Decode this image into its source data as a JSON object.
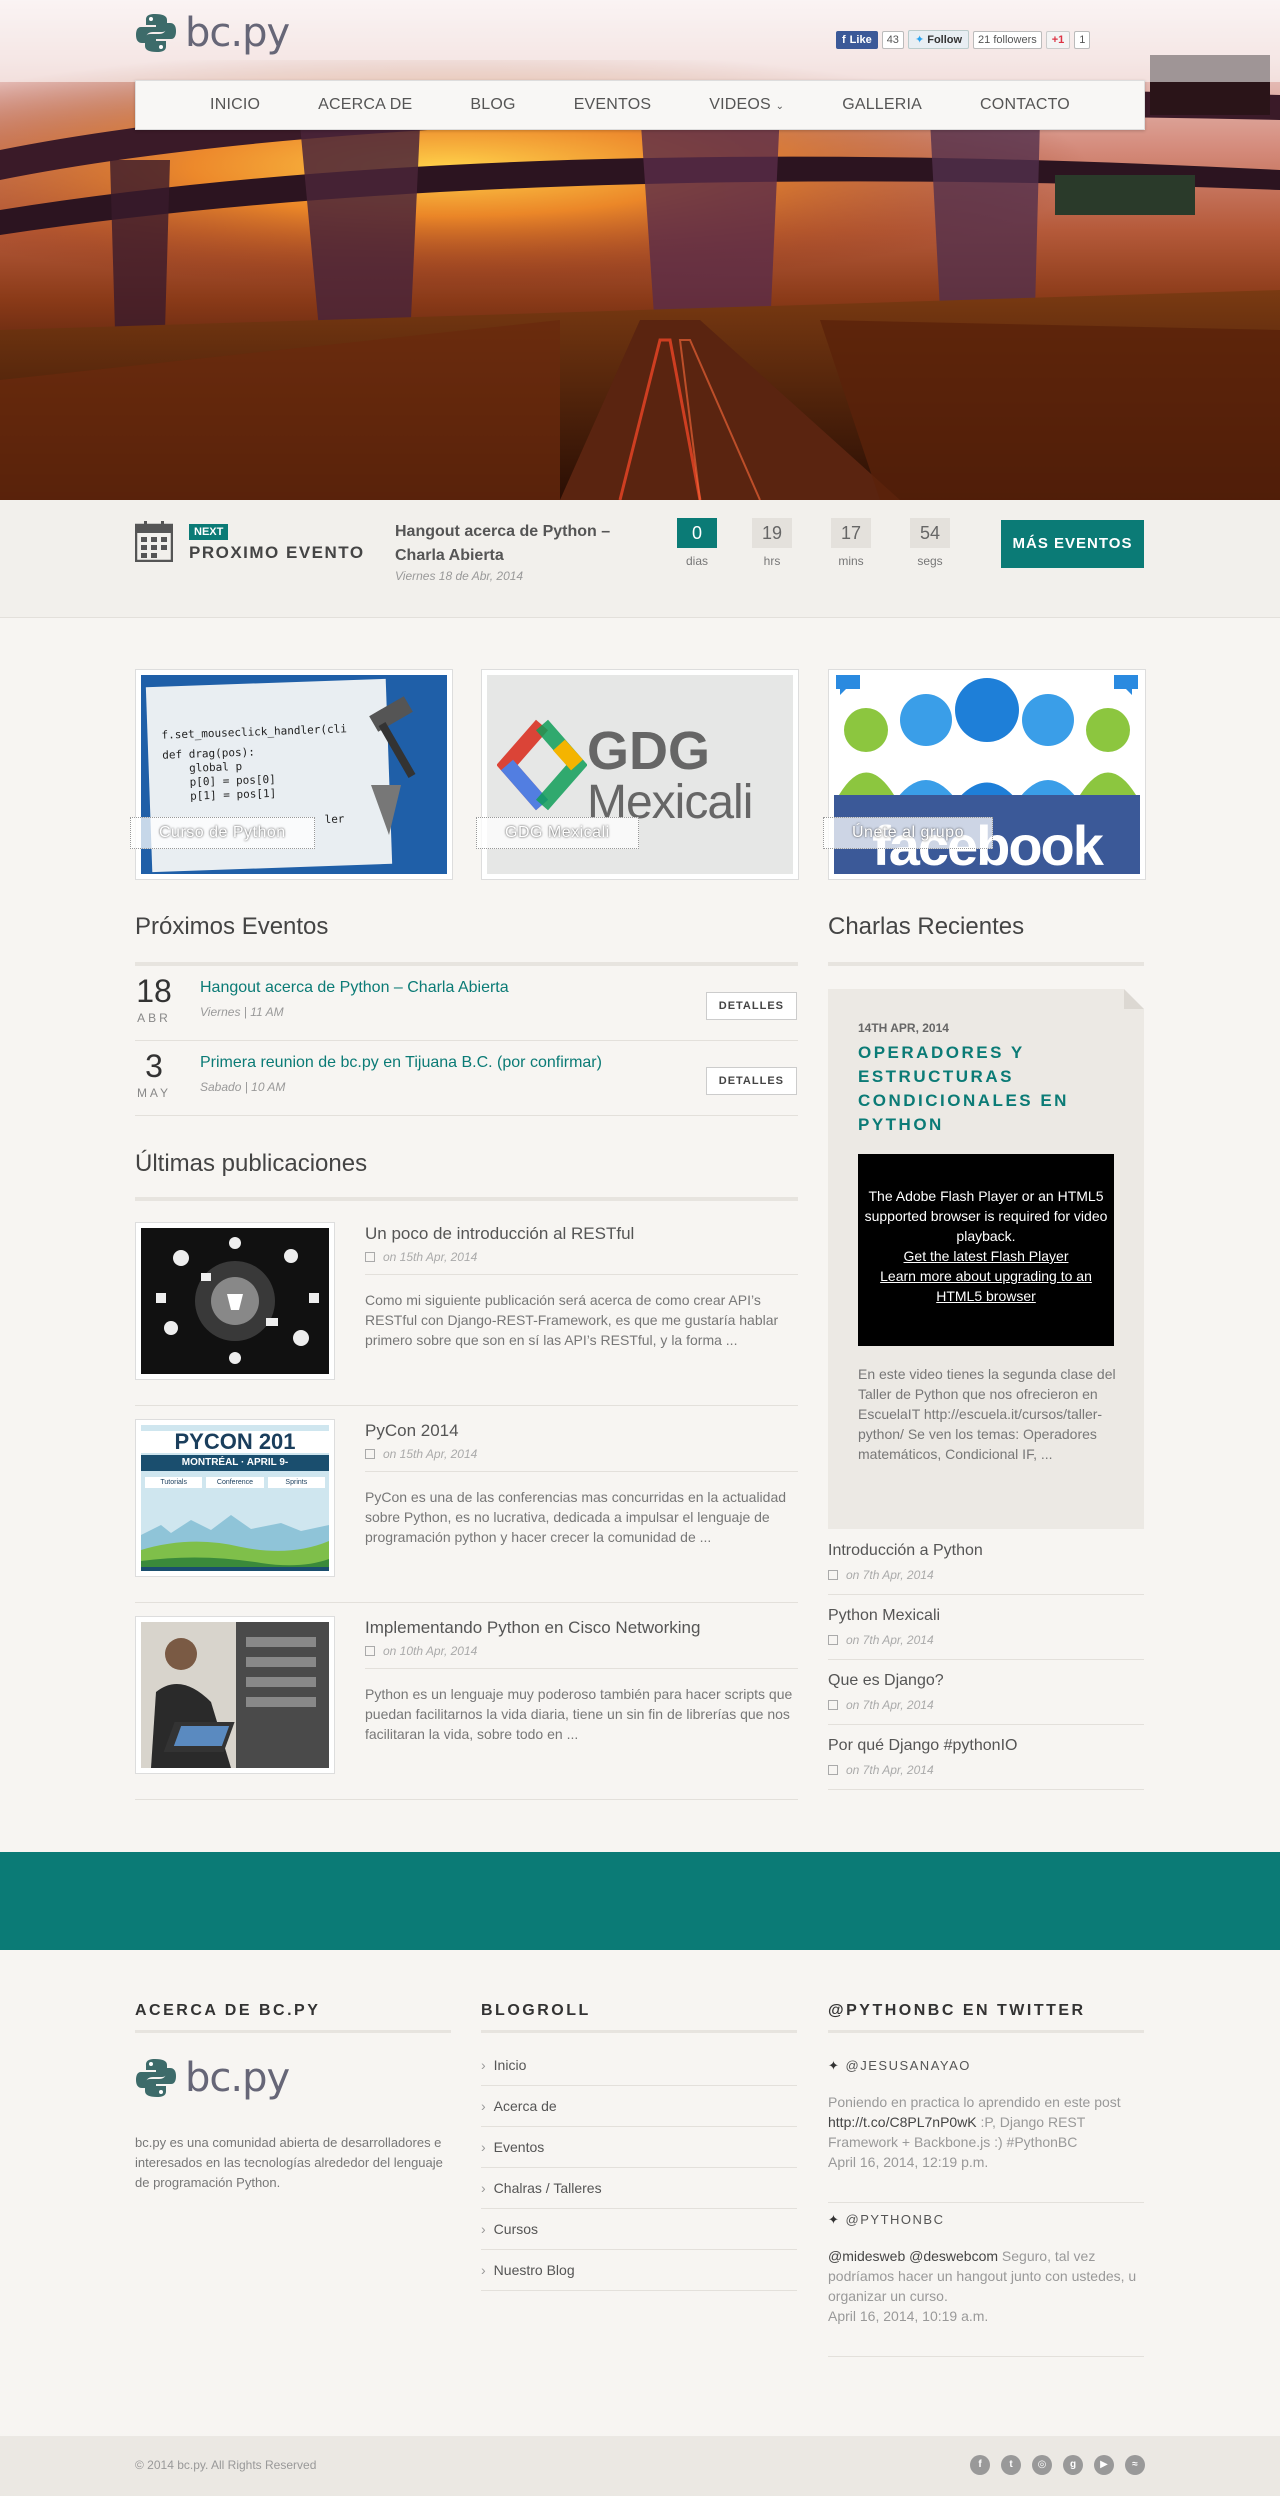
{
  "site": {
    "name": "bc.py"
  },
  "social": {
    "fb_like": "Like",
    "fb_count": "43",
    "tw_follow": "Follow",
    "tw_count": "21 followers",
    "gplus": "+1",
    "gplus_count": "1"
  },
  "nav": [
    "INICIO",
    "ACERCA DE",
    "BLOG",
    "EVENTOS",
    "VIDEOS",
    "GALLERIA",
    "CONTACTO"
  ],
  "next_event": {
    "badge": "NEXT",
    "label": "PROXIMO EVENTO",
    "title": "Hangout acerca de Python – Charla Abierta",
    "date": "Viernes 18 de Abr, 2014",
    "countdown": [
      {
        "value": "0",
        "unit": "dias"
      },
      {
        "value": "19",
        "unit": "hrs"
      },
      {
        "value": "17",
        "unit": "mins"
      },
      {
        "value": "54",
        "unit": "segs"
      }
    ],
    "more_button": "MÁS EVENTOS"
  },
  "features": [
    {
      "caption": "Curso de Python"
    },
    {
      "caption": "GDG Mexicali"
    },
    {
      "caption": "Únete al grupo"
    }
  ],
  "feature_art": {
    "code": [
      "f.set_mouseclick_handler(cli",
      "def drag(pos):",
      "    global p",
      "    p[0] = pos[0]",
      "    p[1] = pos[1]",
      "ler"
    ],
    "gdg_line1": "GDG",
    "gdg_line2": "Mexicali",
    "fb_word": "facebook"
  },
  "upcoming": {
    "heading": "Próximos Eventos",
    "items": [
      {
        "day": "18",
        "month": "ABR",
        "title": "Hangout acerca de Python – Charla Abierta",
        "meta": "Viernes | 11 AM",
        "button": "DETALLES"
      },
      {
        "day": "3",
        "month": "MAY",
        "title": "Primera reunion de bc.py en Tijuana B.C. (por confirmar)",
        "meta": "Sabado | 10 AM",
        "button": "DETALLES"
      }
    ]
  },
  "posts": {
    "heading": "Últimas publicaciones",
    "items": [
      {
        "title": "Un poco de introducción al RESTful",
        "date": "on 15th Apr, 2014",
        "excerpt": "Como mi siguiente publicación será acerca de como crear API’s RESTful con Django-REST-Framework, es que me gustaría hablar primero sobre que son en sí las API’s RESTful, y la forma ..."
      },
      {
        "title": "PyCon 2014",
        "date": "on 15th Apr, 2014",
        "excerpt": "PyCon es una de las conferencias mas concurridas en la actualidad sobre Python, es no lucrativa, dedicada a impulsar el lenguaje de programación python y hacer crecer la comunidad de ..."
      },
      {
        "title": "Implementando Python en Cisco Networking",
        "date": "on 10th Apr, 2014",
        "excerpt": "Python es un lenguaje muy poderoso también para hacer scripts que puedan facilitarnos la vida diaria, tiene un sin fin de librerías que nos facilitaran la vida, sobre todo en ..."
      }
    ],
    "pycon_thumb": {
      "title": "PYCON 201",
      "subtitle": "MONTRÉAL · APRIL 9-",
      "cols": [
        "Tutorials",
        "Conference",
        "Sprints"
      ]
    }
  },
  "talks": {
    "heading": "Charlas Recientes",
    "featured": {
      "date": "14TH APR, 2014",
      "title": "OPERADORES Y ESTRUCTURAS CONDICIONALES EN PYTHON",
      "flash_text": "The Adobe Flash Player or an HTML5 supported browser is required for video playback.",
      "flash_link1": "Get the latest Flash Player",
      "flash_link2": "Learn more about upgrading to an HTML5 browser",
      "excerpt": "En este video tienes la segunda clase del Taller de Python que nos ofrecieron en EscuelaIT http://escuela.it/cursos/taller-python/ Se ven los temas: Operadores matemáticos, Condicional IF, ..."
    },
    "list": [
      {
        "title": "Introducción a Python",
        "date": "on 7th Apr, 2014"
      },
      {
        "title": "Python Mexicali",
        "date": "on 7th Apr, 2014"
      },
      {
        "title": "Que es Django?",
        "date": "on 7th Apr, 2014"
      },
      {
        "title": "Por qué Django #pythonIO",
        "date": "on 7th Apr, 2014"
      }
    ]
  },
  "footer": {
    "about_heading": "ACERCA DE BC.PY",
    "about_text": "bc.py es una comunidad abierta de desarrolladores e interesados en las tecnologías alrededor del lenguaje de programación Python.",
    "blogroll_heading": "BLOGROLL",
    "blogroll": [
      "Inicio",
      "Acerca de",
      "Eventos",
      "Chalras / Talleres",
      "Cursos",
      "Nuestro Blog"
    ],
    "twitter_heading": "@PYTHONBC EN TWITTER",
    "tweets": [
      {
        "user": "@JESUSANAYAO",
        "pre": "Poniendo en practica lo aprendido en este post ",
        "link": "http://t.co/C8PL7nP0wK",
        "post": " :P, Django REST Framework + Backbone.js :) #PythonBC",
        "time": "April 16, 2014, 12:19 p.m."
      },
      {
        "user": "@PYTHONBC",
        "pre": "",
        "link": "@midesweb @deswebcom",
        "post": " Seguro, tal vez podríamos hacer un hangout junto con ustedes, u organizar un curso.",
        "time": "April 16, 2014, 10:19 a.m."
      }
    ],
    "copyright": "© 2014 bc.py. All Rights Reserved",
    "social_icons": [
      "facebook-icon",
      "twitter-icon",
      "dribbble-icon",
      "googleplus-icon",
      "youtube-icon",
      "rss-icon"
    ]
  },
  "colors": {
    "accent": "#0b7b76",
    "background": "#f7f5f2"
  }
}
